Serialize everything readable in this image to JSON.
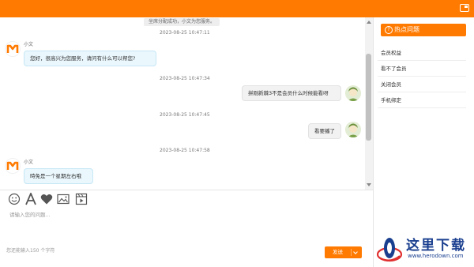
{
  "window": {
    "maximize_icon": "maximize-icon",
    "accent": "#ff7a00"
  },
  "chat": {
    "system_note": "坐席分配成功，小文为您服务。",
    "messages": [
      {
        "time": "2023-08-25 10:47:11",
        "side": "left",
        "sender": "小文",
        "text": "您好，很高兴为您服务，请问有什么可以帮您?"
      },
      {
        "time": "2023-08-25 10:47:34",
        "side": "right",
        "text": "拼刚新棘3不是会员什么时候能看呀"
      },
      {
        "time": "2023-08-25 10:47:45",
        "side": "right",
        "text": "看要播了"
      },
      {
        "time": "2023-08-25 10:47:58",
        "side": "left",
        "sender": "小文",
        "text": "時免是一个星期左右哦"
      }
    ]
  },
  "composer": {
    "tools": [
      "emoji-icon",
      "font-icon",
      "heart-icon",
      "image-icon",
      "video-icon"
    ],
    "placeholder": "请输入您的问题...",
    "counter": "您还能输入150 个字符",
    "send_label": "发送"
  },
  "sidebar": {
    "title": "热点问题",
    "items": [
      {
        "label": "会员权益"
      },
      {
        "label": "看不了会员"
      },
      {
        "label": "关闭会员"
      },
      {
        "label": "手机绑定"
      }
    ]
  },
  "watermark": {
    "name": "这里下载",
    "url": "www.herodown.com"
  }
}
